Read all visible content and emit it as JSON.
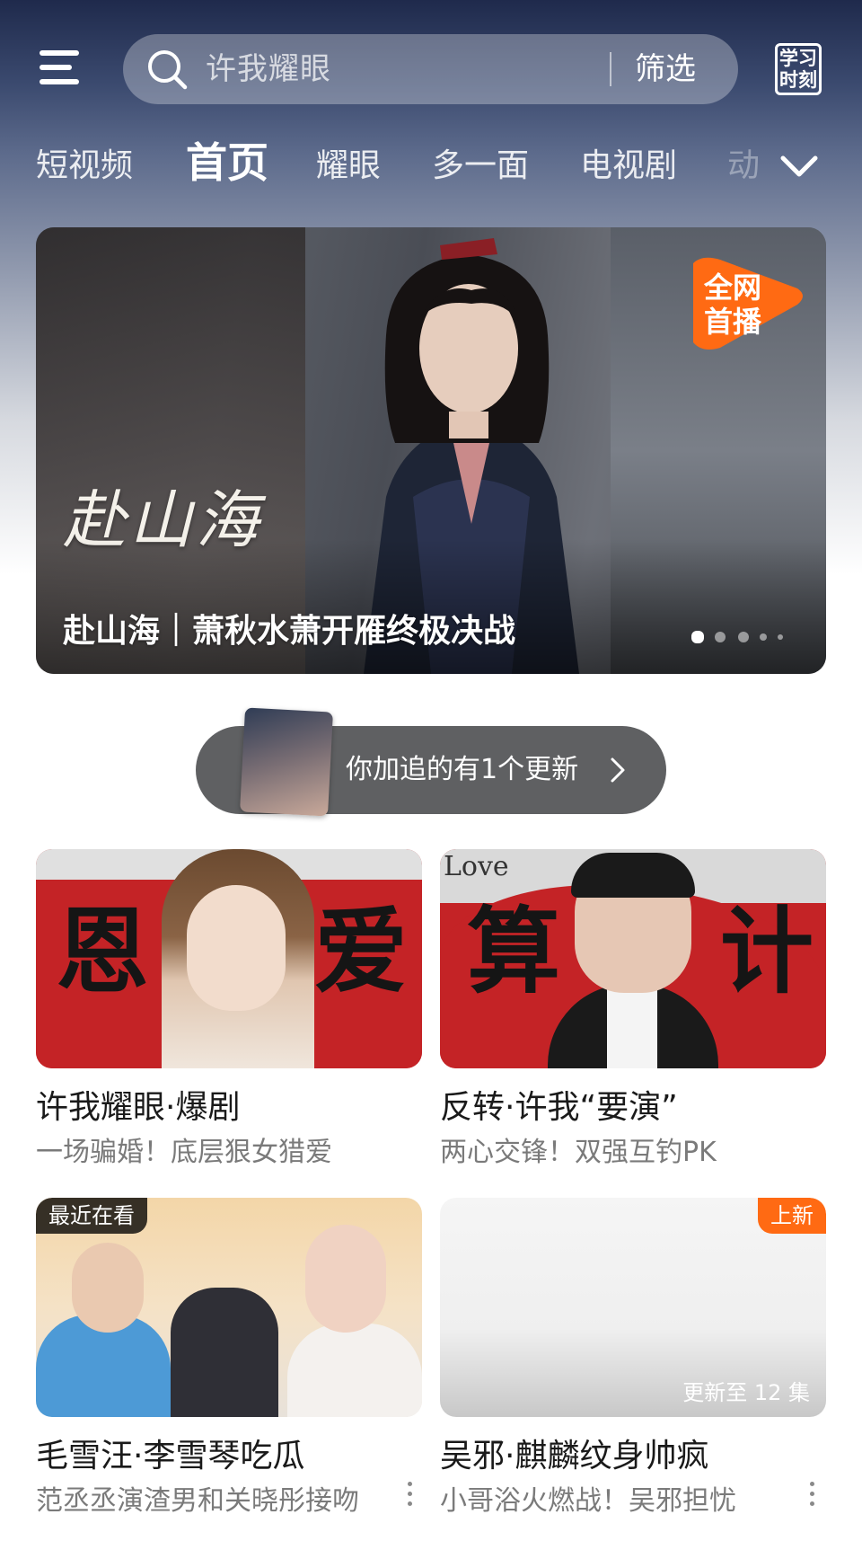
{
  "header": {
    "search": {
      "text": "许我耀眼",
      "filter_label": "筛选"
    },
    "study_label_line1": "学习",
    "study_label_line2": "时刻"
  },
  "tabs": [
    {
      "label": "短视频"
    },
    {
      "label": "首页",
      "active": true
    },
    {
      "label": "耀眼"
    },
    {
      "label": "多一面"
    },
    {
      "label": "电视剧"
    },
    {
      "label": "动"
    }
  ],
  "hero": {
    "calligraphy": "赴山海",
    "badge_line1": "全网",
    "badge_line2": "首播",
    "title": "赴山海｜萧秋水萧开雁终极决战",
    "page_count": 5,
    "active_page": 1
  },
  "follow": {
    "text": "你加追的有1个更新"
  },
  "cards": [
    {
      "title": "许我耀眼·爆剧",
      "subtitle": "一场骗婚！底层狠女猎爱",
      "art_left": "恩",
      "art_right": "爱"
    },
    {
      "title": "反转·许我“要演”",
      "subtitle": "两心交锋！双强互钓PK",
      "art_left": "算",
      "art_right": "计",
      "art_corner": "Love"
    },
    {
      "title": "毛雪汪·李雪琴吃瓜",
      "subtitle": "范丞丞演渣男和关晓彤接吻",
      "badge": "最近在看"
    },
    {
      "title": "吴邪·麒麟纹身帅疯",
      "subtitle": "小哥浴火燃战！吴邪担忧",
      "badge": "上新",
      "episode": "更新至 12 集"
    }
  ],
  "colors": {
    "accent_orange": "#ff6a13",
    "header_navy": "#1f2a4c"
  }
}
